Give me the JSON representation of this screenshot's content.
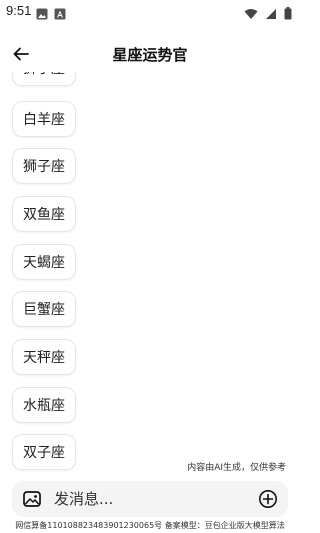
{
  "status_bar": {
    "time": "9:51",
    "icons": [
      "gallery-icon",
      "notification-a-icon",
      "wifi-icon",
      "signal-icon",
      "battery-icon"
    ]
  },
  "header": {
    "title": "星座运势官",
    "back_icon": "arrow-left-icon"
  },
  "suggestions": [
    "狮子座",
    "白羊座",
    "狮子座",
    "双鱼座",
    "天蝎座",
    "巨蟹座",
    "天秤座",
    "水瓶座",
    "双子座"
  ],
  "ai_notice": "内容由AI生成，仅供参考",
  "composer": {
    "placeholder": "发消息...",
    "image_icon": "image-icon",
    "add_icon": "plus-circle-icon"
  },
  "footer": "网信算备110108823483901230065号 备案模型：豆包企业版大模型算法",
  "colors": {
    "background": "#ffffff",
    "chip_border": "#e6e6e6",
    "composer_bg": "#f4f4f5",
    "text": "#111111"
  }
}
